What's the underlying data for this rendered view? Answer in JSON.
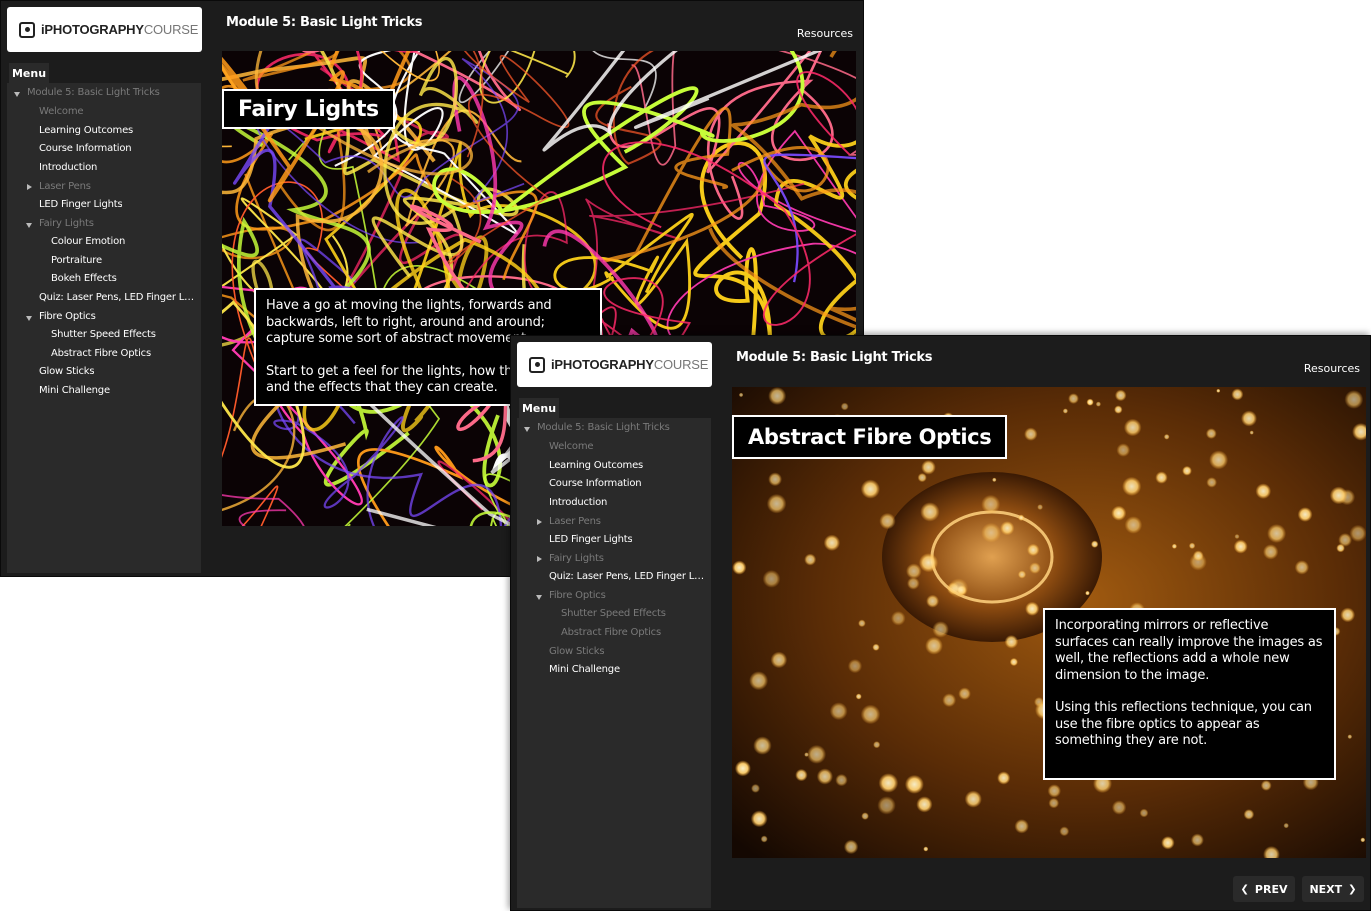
{
  "windows": [
    {
      "logo": {
        "bold": "iPHOTOGRAPHY",
        "light": "COURSE"
      },
      "module_title": "Module 5: Basic Light Tricks",
      "resources_label": "Resources",
      "menu_label": "Menu",
      "menu_items": [
        {
          "label": "Module 5: Basic Light Tricks",
          "state": "dim",
          "arrow": "down"
        },
        {
          "label": "Welcome",
          "state": "dim"
        },
        {
          "label": "Learning Outcomes",
          "state": "bright"
        },
        {
          "label": "Course Information",
          "state": "bright"
        },
        {
          "label": "Introduction",
          "state": "bright"
        },
        {
          "label": "Laser Pens",
          "state": "dim",
          "arrow": "right"
        },
        {
          "label": "LED Finger Lights",
          "state": "bright"
        },
        {
          "label": "Fairy Lights",
          "state": "dim",
          "arrow": "down"
        },
        {
          "label": "Colour Emotion",
          "state": "bright"
        },
        {
          "label": "Portraiture",
          "state": "bright"
        },
        {
          "label": "Bokeh Effects",
          "state": "bright"
        },
        {
          "label": "Quiz: Laser Pens, LED Finger Ligh...",
          "state": "bright"
        },
        {
          "label": "Fibre Optics",
          "state": "bright",
          "arrow": "down"
        },
        {
          "label": "Shutter Speed Effects",
          "state": "bright"
        },
        {
          "label": "Abstract Fibre Optics",
          "state": "bright"
        },
        {
          "label": "Glow Sticks",
          "state": "bright"
        },
        {
          "label": "Mini Challenge",
          "state": "bright"
        }
      ],
      "slide": {
        "title": "Fairy Lights",
        "paragraphs": [
          "Have a go at moving the lights, forwards and backwards, left to right, around and around; capture some sort of abstract movement.",
          "Start to get a feel for the lights, how they move and the effects that they can create."
        ]
      }
    },
    {
      "logo": {
        "bold": "iPHOTOGRAPHY",
        "light": "COURSE"
      },
      "module_title": "Module 5: Basic Light Tricks",
      "resources_label": "Resources",
      "menu_label": "Menu",
      "menu_items": [
        {
          "label": "Module 5: Basic Light Tricks",
          "state": "dim",
          "arrow": "down"
        },
        {
          "label": "Welcome",
          "state": "dim"
        },
        {
          "label": "Learning Outcomes",
          "state": "bright"
        },
        {
          "label": "Course Information",
          "state": "bright"
        },
        {
          "label": "Introduction",
          "state": "bright"
        },
        {
          "label": "Laser Pens",
          "state": "dim",
          "arrow": "right"
        },
        {
          "label": "LED Finger Lights",
          "state": "bright"
        },
        {
          "label": "Fairy Lights",
          "state": "dim",
          "arrow": "right"
        },
        {
          "label": "Quiz: Laser Pens, LED Finger Ligh...",
          "state": "bright"
        },
        {
          "label": "Fibre Optics",
          "state": "dim",
          "arrow": "down"
        },
        {
          "label": "Shutter Speed Effects",
          "state": "dim"
        },
        {
          "label": "Abstract Fibre Optics",
          "state": "dim"
        },
        {
          "label": "Glow Sticks",
          "state": "dim"
        },
        {
          "label": "Mini Challenge",
          "state": "bright"
        }
      ],
      "slide": {
        "title": "Abstract Fibre Optics",
        "paragraphs": [
          "Incorporating mirrors or reflective surfaces can really improve the images as well, the reflections add a whole new dimension to the image.",
          "Using this reflections technique, you can use the fibre optics to appear as something they are not."
        ]
      },
      "nav": {
        "prev": "PREV",
        "next": "NEXT"
      }
    }
  ],
  "icons": [
    "camera-logo-icon",
    "chevron-left-icon",
    "chevron-right-icon",
    "caret-down-icon",
    "caret-right-icon"
  ]
}
